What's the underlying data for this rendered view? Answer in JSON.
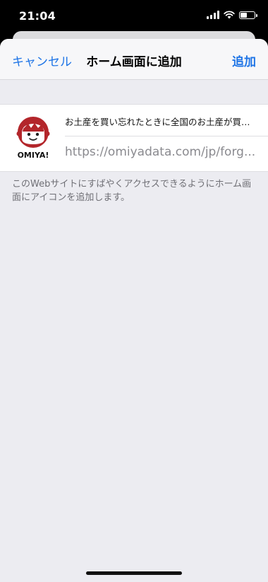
{
  "status_bar": {
    "time": "21:04",
    "battery_level": 0.55,
    "icons": [
      "cellular-signal-icon",
      "wifi-icon",
      "battery-icon"
    ]
  },
  "nav": {
    "cancel_label": "キャンセル",
    "title": "ホーム画面に追加",
    "add_label": "追加"
  },
  "shortcut": {
    "name": "お土産を買い忘れたときに全国のお土産が買…",
    "url": "https://omiyadata.com/jp/forg...",
    "icon_text": "OMIYA!",
    "icon_color": "#b3262b"
  },
  "footnote": "このWebサイトにすばやくアクセスできるようにホーム画面にアイコンを追加します。",
  "colors": {
    "accent": "#1e74e6",
    "sheet_background": "#ececf1"
  }
}
